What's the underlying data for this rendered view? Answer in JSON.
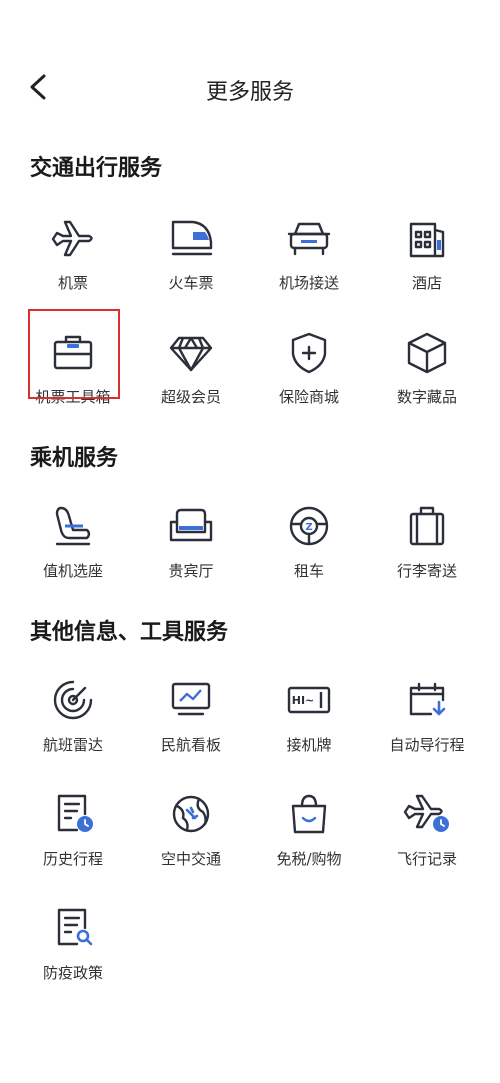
{
  "header": {
    "title": "更多服务"
  },
  "sections": [
    {
      "title": "交通出行服务",
      "items": [
        {
          "label": "机票",
          "icon": "airplane-icon"
        },
        {
          "label": "火车票",
          "icon": "train-icon"
        },
        {
          "label": "机场接送",
          "icon": "car-icon"
        },
        {
          "label": "酒店",
          "icon": "hotel-icon"
        },
        {
          "label": "机票工具箱",
          "icon": "briefcase-icon",
          "highlight_color": "#d9302f"
        },
        {
          "label": "超级会员",
          "icon": "diamond-icon"
        },
        {
          "label": "保险商城",
          "icon": "shield-plus-icon"
        },
        {
          "label": "数字藏品",
          "icon": "cube-icon"
        }
      ]
    },
    {
      "title": "乘机服务",
      "items": [
        {
          "label": "值机选座",
          "icon": "seat-icon"
        },
        {
          "label": "贵宾厅",
          "icon": "sofa-icon"
        },
        {
          "label": "租车",
          "icon": "steering-wheel-icon"
        },
        {
          "label": "行李寄送",
          "icon": "luggage-icon"
        }
      ]
    },
    {
      "title": "其他信息、工具服务",
      "items": [
        {
          "label": "航班雷达",
          "icon": "radar-icon"
        },
        {
          "label": "民航看板",
          "icon": "monitor-chart-icon"
        },
        {
          "label": "接机牌",
          "icon": "sign-board-icon"
        },
        {
          "label": "自动导行程",
          "icon": "calendar-import-icon"
        },
        {
          "label": "历史行程",
          "icon": "document-clock-icon"
        },
        {
          "label": "空中交通",
          "icon": "globe-plane-icon"
        },
        {
          "label": "免税/购物",
          "icon": "shopping-bag-icon"
        },
        {
          "label": "飞行记录",
          "icon": "plane-clock-icon"
        },
        {
          "label": "防疫政策",
          "icon": "document-search-icon"
        }
      ]
    }
  ],
  "colors": {
    "icon_stroke": "#2a2f3a",
    "accent": "#3d6fd8",
    "highlight": "#d9302f"
  }
}
